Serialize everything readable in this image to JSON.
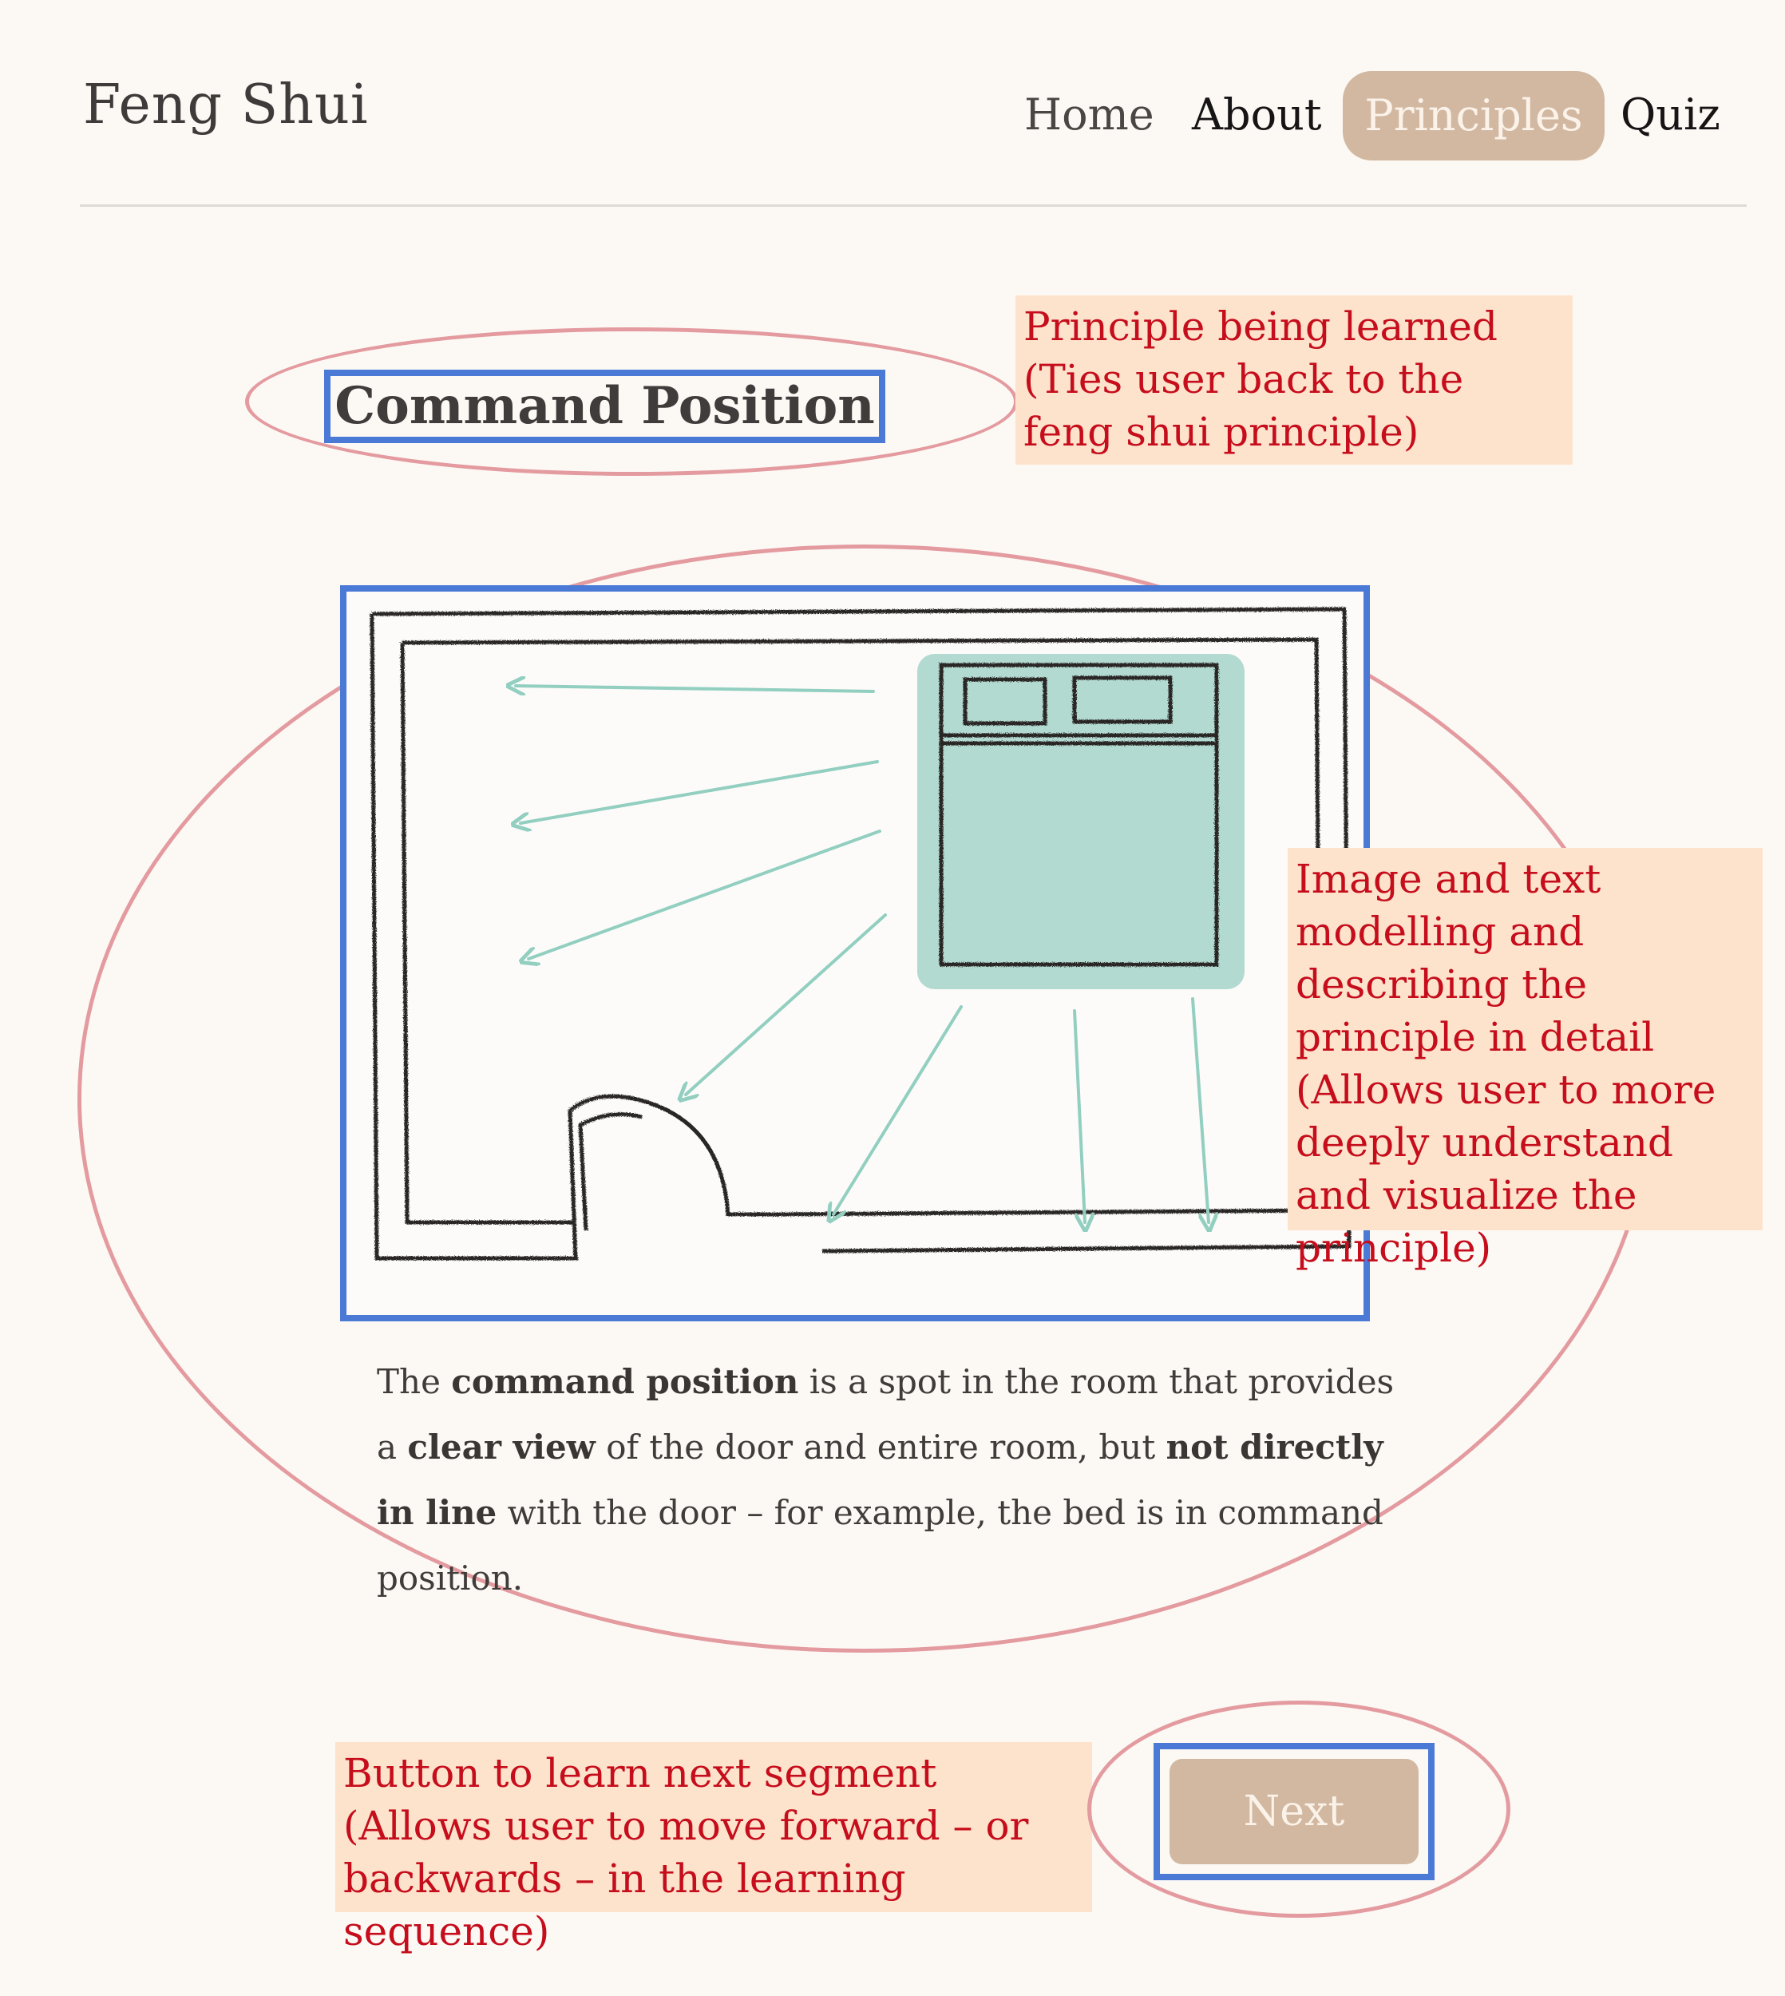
{
  "header": {
    "brand": "Feng Shui",
    "nav": {
      "home": "Home",
      "about": "About",
      "principles": "Principles",
      "quiz": "Quiz"
    },
    "active_item": "Principles"
  },
  "main": {
    "title": "Command Position",
    "description": {
      "part1": "The ",
      "bold1": "command position",
      "part2": " is a spot in the room that provides a ",
      "bold2": "clear view",
      "part3": " of the door and entire room, but ",
      "bold3": "not directly in line",
      "part4": " with the door – for example, the bed is in command position."
    },
    "next_label": "Next"
  },
  "annotations": {
    "title_note": "Principle being learned (Ties user back to the feng shui principle)",
    "image_note": "Image and text modelling and describing the principle in detail (Allows user to more deeply understand and visualize the principle)",
    "next_note": "Button to learn next segment (Allows user to move forward – or backwards – in the learning sequence)"
  },
  "colors": {
    "background": "#fcf9f5",
    "accent": "#d2b8a1",
    "annotation_box": "#fde3cc",
    "annotation_text": "#c60d1c",
    "highlight_outline": "#4a79d6",
    "ellipse_outline": "#e49ba0",
    "sketch_teal": "#92cfc0"
  }
}
